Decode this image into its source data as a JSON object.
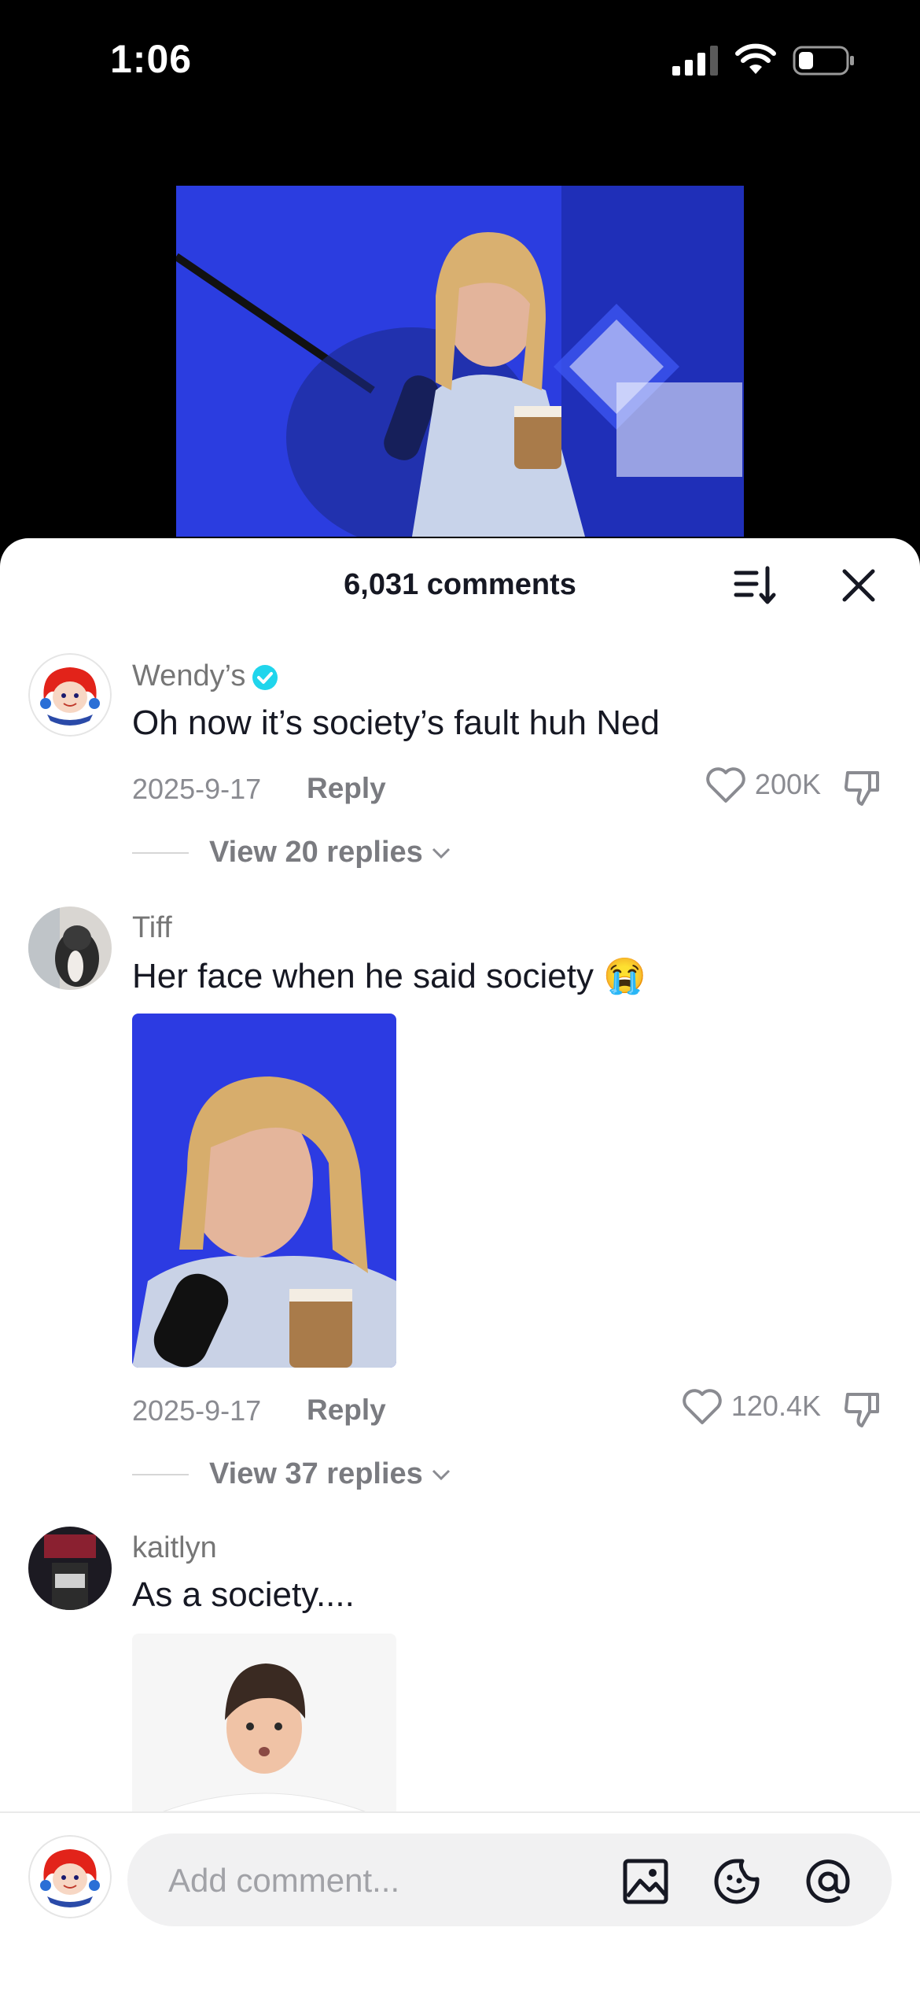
{
  "status_bar": {
    "time": "1:06"
  },
  "comments_panel": {
    "title": "6,031 comments",
    "sort_icon": "sort-icon",
    "close_icon": "close-icon"
  },
  "comments": [
    {
      "username": "Wendy’s",
      "verified": true,
      "text": "Oh now it’s society’s fault huh Ned",
      "date": "2025-9-17",
      "reply_label": "Reply",
      "likes": "200K",
      "view_replies": "View 20 replies"
    },
    {
      "username": "Tiff",
      "verified": false,
      "text": "Her face when he said society 😭",
      "date": "2025-9-17",
      "reply_label": "Reply",
      "likes": "120.4K",
      "view_replies": "View 37 replies"
    },
    {
      "username": "kaitlyn",
      "verified": false,
      "text": "As a society...."
    }
  ],
  "composer": {
    "placeholder": "Add comment...",
    "icons": [
      "image-icon",
      "sticker-icon",
      "mention-icon"
    ]
  },
  "colors": {
    "verified": "#20d5ec",
    "accent_text": "#161823",
    "muted": "#8a8b91"
  }
}
